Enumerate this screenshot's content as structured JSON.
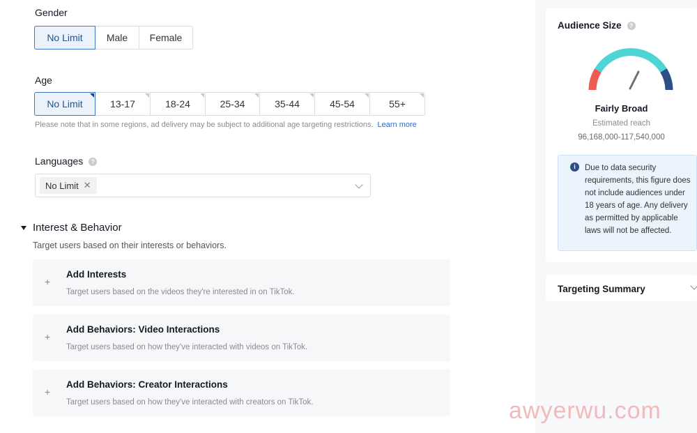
{
  "gender": {
    "label": "Gender",
    "options": [
      "No Limit",
      "Male",
      "Female"
    ]
  },
  "age": {
    "label": "Age",
    "options": [
      "No Limit",
      "13-17",
      "18-24",
      "25-34",
      "35-44",
      "45-54",
      "55+"
    ],
    "note": "Please note that in some regions, ad delivery may be subject to additional age targeting restrictions.",
    "learn_more": "Learn more"
  },
  "languages": {
    "label": "Languages",
    "tag": "No Limit"
  },
  "interest": {
    "title": "Interest & Behavior",
    "subtitle": "Target users based on their interests or behaviors.",
    "cards": [
      {
        "title": "Add Interests",
        "sub": "Target users based on the videos they're interested in on TikTok."
      },
      {
        "title": "Add Behaviors: Video Interactions",
        "sub": "Target users based on how they've interacted with videos on TikTok."
      },
      {
        "title": "Add Behaviors: Creator Interactions",
        "sub": "Target users based on how they've interacted with creators on TikTok."
      }
    ]
  },
  "audience": {
    "title": "Audience Size",
    "level": "Fairly Broad",
    "estimated_label": "Estimated reach",
    "range": "96,168,000-117,540,000",
    "info": "Due to data security requirements, this figure does not include audiences under 18 years of age. Any delivery as permitted by applicable laws will not be affected."
  },
  "summary": {
    "title": "Targeting Summary"
  },
  "watermark": "awyerwu.com",
  "colors": {
    "selected_border": "#3f77c4",
    "gauge_red": "#ef5a52",
    "gauge_cyan": "#4fd4d6",
    "gauge_navy": "#2d4e86"
  }
}
